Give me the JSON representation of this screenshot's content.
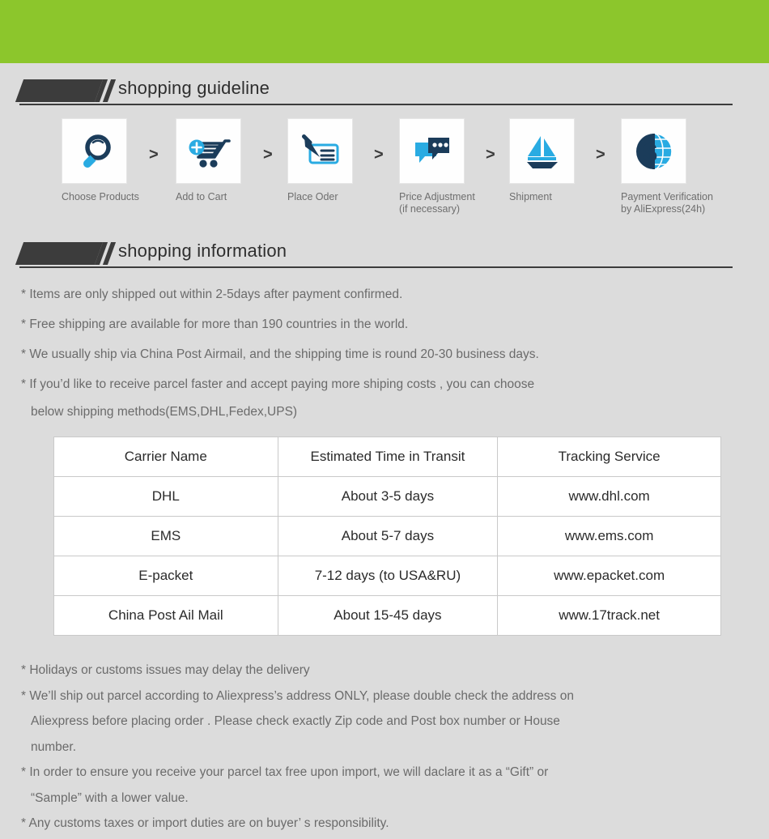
{
  "theme": {
    "banner_green": "#8cc62c",
    "page_background": "#dcdcdc",
    "heading_dark": "#3c3c3c",
    "icon_navy": "#1b3c5a",
    "icon_cyan": "#29abe2",
    "body_text": "#6b6b6b"
  },
  "sections": {
    "guideline": {
      "title": "shopping guideline"
    },
    "information": {
      "title": "shopping information"
    }
  },
  "steps": [
    {
      "icon": "magnifier-icon",
      "label_line1": "Choose Products",
      "label_line2": ""
    },
    {
      "icon": "add-to-cart-icon",
      "label_line1": "Add to Cart",
      "label_line2": ""
    },
    {
      "icon": "pen-check-icon",
      "label_line1": "Place Oder",
      "label_line2": ""
    },
    {
      "icon": "chat-bubbles-icon",
      "label_line1": "Price Adjustment",
      "label_line2": "(if necessary)"
    },
    {
      "icon": "sailboat-icon",
      "label_line1": "Shipment",
      "label_line2": ""
    },
    {
      "icon": "dollar-globe-icon",
      "label_line1": "Payment Verification",
      "label_line2": "by AliExpress(24h)"
    }
  ],
  "step_separator": ">",
  "info_lines": [
    {
      "text": "* Items are only shipped out within 2-5days after payment confirmed.",
      "indent": false
    },
    {
      "text": "* Free shipping are available for more than 190 countries in the world.",
      "indent": false
    },
    {
      "text": "* We usually ship via China Post Airmail, and the shipping time is round 20-30 business days.",
      "indent": false
    },
    {
      "text": "* If you’d like to receive parcel faster and accept paying more shiping costs , you can choose",
      "indent": false
    },
    {
      "text": "below shipping methods(EMS,DHL,Fedex,UPS)",
      "indent": true
    }
  ],
  "carrier_table": {
    "headers": [
      "Carrier Name",
      "Estimated Time in Transit",
      "Tracking Service"
    ],
    "rows": [
      [
        "DHL",
        "About 3-5 days",
        "www.dhl.com"
      ],
      [
        "EMS",
        "About 5-7 days",
        "www.ems.com"
      ],
      [
        "E-packet",
        "7-12 days (to USA&RU)",
        "www.epacket.com"
      ],
      [
        "China Post Ail Mail",
        "About 15-45 days",
        "www.17track.net"
      ]
    ]
  },
  "notes": [
    {
      "text": "* Holidays or customs issues may delay the delivery",
      "indent": false
    },
    {
      "text": "* We’ll ship out parcel according to Aliexpress’s address ONLY, please double check the address on",
      "indent": false
    },
    {
      "text": "Aliexpress before placing order . Please check exactly Zip code and Post box  number or House",
      "indent": true
    },
    {
      "text": "number.",
      "indent": true
    },
    {
      "text": "* In order to ensure you receive your parcel tax free upon import, we will daclare it as a  “Gift”  or",
      "indent": false
    },
    {
      "text": "“Sample”  with a lower value.",
      "indent": true
    },
    {
      "text": "* Any customs taxes or import duties are on buyer’ s responsibility.",
      "indent": false
    }
  ]
}
